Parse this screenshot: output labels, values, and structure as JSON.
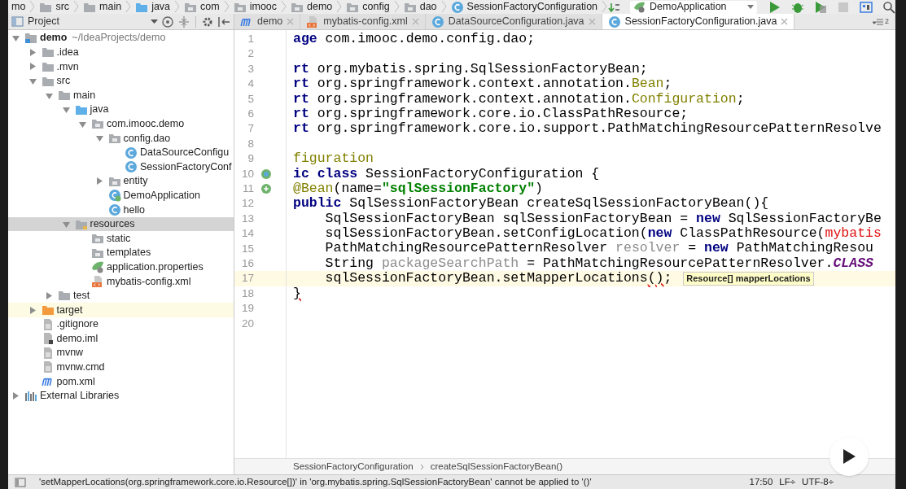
{
  "nav_bar": {
    "breadcrumbs": [
      {
        "label": "mo",
        "kind": "module"
      },
      {
        "label": "src",
        "kind": "folder"
      },
      {
        "label": "main",
        "kind": "folder"
      },
      {
        "label": "java",
        "kind": "source"
      },
      {
        "label": "com",
        "kind": "package"
      },
      {
        "label": "imooc",
        "kind": "package"
      },
      {
        "label": "demo",
        "kind": "package"
      },
      {
        "label": "config",
        "kind": "package"
      },
      {
        "label": "dao",
        "kind": "package"
      },
      {
        "label": "SessionFactoryConfiguration",
        "kind": "class"
      }
    ],
    "run_config": "DemoApplication"
  },
  "project_panel": {
    "title": "Project",
    "tree": [
      {
        "label": "demo",
        "detail": "~/IdeaProjects/demo",
        "kind": "module",
        "expanded": true,
        "selected": false,
        "children": [
          {
            "label": ".idea",
            "kind": "folder",
            "expanded": false,
            "selected": false
          },
          {
            "label": ".mvn",
            "kind": "folder",
            "expanded": false,
            "selected": false
          },
          {
            "label": "src",
            "kind": "folder",
            "expanded": true,
            "selected": false,
            "children": [
              {
                "label": "main",
                "kind": "folder",
                "expanded": true,
                "selected": false,
                "children": [
                  {
                    "label": "java",
                    "kind": "source",
                    "expanded": true,
                    "selected": false,
                    "children": [
                      {
                        "label": "com.imooc.demo",
                        "kind": "package",
                        "expanded": true,
                        "selected": false,
                        "children": [
                          {
                            "label": "config.dao",
                            "kind": "package",
                            "expanded": true,
                            "selected": false,
                            "children": [
                              {
                                "label": "DataSourceConfigu",
                                "kind": "class",
                                "selected": false
                              },
                              {
                                "label": "SessionFactoryConf",
                                "kind": "class",
                                "selected": false
                              }
                            ]
                          },
                          {
                            "label": "entity",
                            "kind": "package",
                            "expanded": false,
                            "selected": false
                          },
                          {
                            "label": "DemoApplication",
                            "kind": "spring-class",
                            "selected": false
                          },
                          {
                            "label": "hello",
                            "kind": "class",
                            "selected": false
                          }
                        ]
                      }
                    ]
                  },
                  {
                    "label": "resources",
                    "kind": "resources",
                    "expanded": true,
                    "selected": true,
                    "children": [
                      {
                        "label": "static",
                        "kind": "package",
                        "selected": false
                      },
                      {
                        "label": "templates",
                        "kind": "package",
                        "selected": false
                      },
                      {
                        "label": "application.properties",
                        "kind": "properties",
                        "selected": false
                      },
                      {
                        "label": "mybatis-config.xml",
                        "kind": "xml",
                        "selected": false
                      }
                    ]
                  }
                ]
              },
              {
                "label": "test",
                "kind": "folder",
                "expanded": false,
                "selected": false
              }
            ]
          },
          {
            "label": "target",
            "kind": "excluded",
            "expanded": false,
            "selected": false
          },
          {
            "label": ".gitignore",
            "kind": "file",
            "selected": false
          },
          {
            "label": "demo.iml",
            "kind": "iml",
            "selected": false
          },
          {
            "label": "mvnw",
            "kind": "file",
            "selected": false
          },
          {
            "label": "mvnw.cmd",
            "kind": "file",
            "selected": false
          },
          {
            "label": "pom.xml",
            "kind": "maven",
            "selected": false
          }
        ]
      },
      {
        "label": "External Libraries",
        "kind": "libraries",
        "expanded": false,
        "selected": false
      }
    ]
  },
  "tabs": [
    {
      "label": "demo",
      "kind": "maven",
      "selected": false
    },
    {
      "label": "mybatis-config.xml",
      "kind": "xml",
      "selected": false
    },
    {
      "label": "DataSourceConfiguration.java",
      "kind": "class",
      "selected": false
    },
    {
      "label": "SessionFactoryConfiguration.java",
      "kind": "class",
      "selected": true
    }
  ],
  "tab_overflow_count": "2",
  "editor": {
    "lines": [
      {
        "number": "1",
        "current": false,
        "segments": [
          {
            "kind": "kw",
            "text": "age"
          },
          {
            "kind": "plain",
            "text": " com.imooc.demo.config.dao;"
          }
        ]
      },
      {
        "number": "2",
        "current": false
      },
      {
        "number": "3",
        "current": false,
        "segments": [
          {
            "kind": "kw",
            "text": "rt"
          },
          {
            "kind": "plain",
            "text": " org.mybatis.spring.SqlSessionFactoryBean;"
          }
        ]
      },
      {
        "number": "4",
        "current": false,
        "segments": [
          {
            "kind": "kw",
            "text": "rt"
          },
          {
            "kind": "plain",
            "text": " org.springframework.context.annotation."
          },
          {
            "kind": "ann",
            "text": "Bean"
          },
          {
            "kind": "plain",
            "text": ";"
          }
        ]
      },
      {
        "number": "5",
        "current": false,
        "segments": [
          {
            "kind": "kw",
            "text": "rt"
          },
          {
            "kind": "plain",
            "text": " org.springframework.context.annotation."
          },
          {
            "kind": "ann",
            "text": "Configuration"
          },
          {
            "kind": "plain",
            "text": ";"
          }
        ]
      },
      {
        "number": "6",
        "current": false,
        "segments": [
          {
            "kind": "kw",
            "text": "rt"
          },
          {
            "kind": "plain",
            "text": " org.springframework.core.io.ClassPathResource;"
          }
        ]
      },
      {
        "number": "7",
        "current": false,
        "segments": [
          {
            "kind": "kw",
            "text": "rt"
          },
          {
            "kind": "plain",
            "text": " org.springframework.core.io.support.PathMatchingResourcePatternResolve"
          }
        ]
      },
      {
        "number": "8",
        "current": false
      },
      {
        "number": "9",
        "current": false,
        "segments": [
          {
            "kind": "ann",
            "text": "figuration"
          }
        ]
      },
      {
        "number": "10",
        "current": false,
        "kind": "bean",
        "segments": [
          {
            "kind": "kw",
            "text": "ic class"
          },
          {
            "kind": "plain",
            "text": " SessionFactoryConfiguration {"
          }
        ]
      },
      {
        "number": "11",
        "current": false,
        "kind": "bean-method",
        "segments": [
          {
            "kind": "ann",
            "text": "@Bean"
          },
          {
            "kind": "plain",
            "text": "(name="
          },
          {
            "kind": "str",
            "text": "\"sqlSessionFactory\""
          },
          {
            "kind": "plain",
            "text": ")"
          }
        ]
      },
      {
        "number": "12",
        "current": false,
        "segments": [
          {
            "kind": "kw",
            "text": "public"
          },
          {
            "kind": "plain",
            "text": " SqlSessionFactoryBean createSqlSessionFactoryBean(){"
          }
        ]
      },
      {
        "number": "13",
        "current": false,
        "segments": [
          {
            "kind": "plain",
            "text": "    SqlSessionFactoryBean sqlSessionFactoryBean = "
          },
          {
            "kind": "kw",
            "text": "new"
          },
          {
            "kind": "plain",
            "text": " SqlSessionFactoryBe"
          }
        ]
      },
      {
        "number": "14",
        "current": false,
        "segments": [
          {
            "kind": "plain",
            "text": "    sqlSessionFactoryBean.setConfigLocation("
          },
          {
            "kind": "kw",
            "text": "new"
          },
          {
            "kind": "plain",
            "text": " ClassPathResource("
          },
          {
            "kind": "red",
            "text": "mybatis"
          }
        ]
      },
      {
        "number": "15",
        "current": false,
        "segments": [
          {
            "kind": "plain",
            "text": "    PathMatchingResourcePatternResolver "
          },
          {
            "kind": "param",
            "text": "resolver"
          },
          {
            "kind": "plain",
            "text": " = "
          },
          {
            "kind": "kw",
            "text": "new"
          },
          {
            "kind": "plain",
            "text": " PathMatchingResou"
          }
        ]
      },
      {
        "number": "16",
        "current": false,
        "segments": [
          {
            "kind": "plain",
            "text": "    String "
          },
          {
            "kind": "param",
            "text": "packageSearchPath"
          },
          {
            "kind": "plain",
            "text": " = PathMatchingResourcePatternResolver."
          },
          {
            "kind": "static",
            "text": "CLASS"
          }
        ]
      },
      {
        "number": "17",
        "current": true,
        "segments": [
          {
            "kind": "plain",
            "text": "    sqlSessionFactoryBean.setMapperLocations"
          },
          {
            "kind": "error",
            "text": "()"
          },
          {
            "kind": "plain",
            "text": ";"
          }
        ]
      },
      {
        "number": "18",
        "current": false,
        "segments": [
          {
            "kind": "error",
            "text": "}"
          }
        ]
      },
      {
        "number": "19",
        "current": false
      },
      {
        "number": "20",
        "current": false
      }
    ],
    "parameter_hint": "Resource[] mapperLocations",
    "breadcrumbs": [
      "SessionFactoryConfiguration",
      "createSqlSessionFactoryBean()"
    ]
  },
  "status_bar": {
    "message": "'setMapperLocations(org.springframework.core.io.Resource[])' in 'org.mybatis.spring.SqlSessionFactoryBean' cannot be applied to '()'",
    "position": "17:50",
    "line_separator": "LF÷",
    "encoding": "UTF-8÷"
  }
}
